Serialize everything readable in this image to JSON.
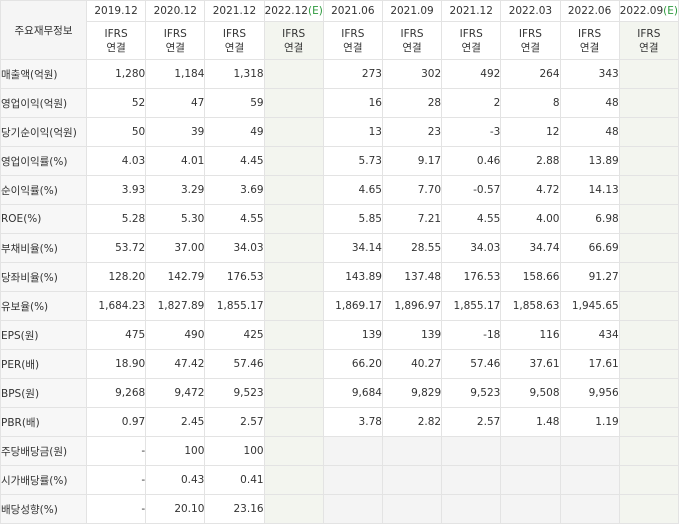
{
  "corner_label": "주요재무정보",
  "periods": [
    {
      "label": "2019.12",
      "est": false
    },
    {
      "label": "2020.12",
      "est": false
    },
    {
      "label": "2021.12",
      "est": false
    },
    {
      "label": "2022.12",
      "est": true
    },
    {
      "label": "2021.06",
      "est": false
    },
    {
      "label": "2021.09",
      "est": false
    },
    {
      "label": "2021.12",
      "est": false
    },
    {
      "label": "2022.03",
      "est": false
    },
    {
      "label": "2022.06",
      "est": false
    },
    {
      "label": "2022.09",
      "est": true
    }
  ],
  "est_mark": "(E)",
  "basis_line1": "IFRS",
  "basis_line2": "연결",
  "rows": [
    {
      "label": "매출액(억원)",
      "values": [
        "1,280",
        "1,184",
        "1,318",
        "",
        "273",
        "302",
        "492",
        "264",
        "343",
        ""
      ]
    },
    {
      "label": "영업이익(억원)",
      "values": [
        "52",
        "47",
        "59",
        "",
        "16",
        "28",
        "2",
        "8",
        "48",
        ""
      ]
    },
    {
      "label": "당기순이익(억원)",
      "values": [
        "50",
        "39",
        "49",
        "",
        "13",
        "23",
        "-3",
        "12",
        "48",
        ""
      ]
    },
    {
      "label": "영업이익률(%)",
      "values": [
        "4.03",
        "4.01",
        "4.45",
        "",
        "5.73",
        "9.17",
        "0.46",
        "2.88",
        "13.89",
        ""
      ]
    },
    {
      "label": "순이익률(%)",
      "values": [
        "3.93",
        "3.29",
        "3.69",
        "",
        "4.65",
        "7.70",
        "-0.57",
        "4.72",
        "14.13",
        ""
      ]
    },
    {
      "label": "ROE(%)",
      "values": [
        "5.28",
        "5.30",
        "4.55",
        "",
        "5.85",
        "7.21",
        "4.55",
        "4.00",
        "6.98",
        ""
      ]
    },
    {
      "label": "부채비율(%)",
      "values": [
        "53.72",
        "37.00",
        "34.03",
        "",
        "34.14",
        "28.55",
        "34.03",
        "34.74",
        "66.69",
        ""
      ]
    },
    {
      "label": "당좌비율(%)",
      "values": [
        "128.20",
        "142.79",
        "176.53",
        "",
        "143.89",
        "137.48",
        "176.53",
        "158.66",
        "91.27",
        ""
      ]
    },
    {
      "label": "유보율(%)",
      "values": [
        "1,684.23",
        "1,827.89",
        "1,855.17",
        "",
        "1,869.17",
        "1,896.97",
        "1,855.17",
        "1,858.63",
        "1,945.65",
        ""
      ]
    },
    {
      "label": "EPS(원)",
      "values": [
        "475",
        "490",
        "425",
        "",
        "139",
        "139",
        "-18",
        "116",
        "434",
        ""
      ]
    },
    {
      "label": "PER(배)",
      "values": [
        "18.90",
        "47.42",
        "57.46",
        "",
        "66.20",
        "40.27",
        "57.46",
        "37.61",
        "17.61",
        ""
      ]
    },
    {
      "label": "BPS(원)",
      "values": [
        "9,268",
        "9,472",
        "9,523",
        "",
        "9,684",
        "9,829",
        "9,523",
        "9,508",
        "9,956",
        ""
      ]
    },
    {
      "label": "PBR(배)",
      "values": [
        "0.97",
        "2.45",
        "2.57",
        "",
        "3.78",
        "2.82",
        "2.57",
        "1.48",
        "1.19",
        ""
      ]
    },
    {
      "label": "주당배당금(원)",
      "values": [
        "-",
        "100",
        "100",
        "",
        "",
        "",
        "",
        "",
        "",
        ""
      ]
    },
    {
      "label": "시가배당률(%)",
      "values": [
        "-",
        "0.43",
        "0.41",
        "",
        "",
        "",
        "",
        "",
        "",
        ""
      ]
    },
    {
      "label": "배당성향(%)",
      "values": [
        "-",
        "20.10",
        "23.16",
        "",
        "",
        "",
        "",
        "",
        "",
        ""
      ]
    }
  ],
  "colors": {
    "negative": "#e11c1c",
    "basis": "#e4661c",
    "estimate_mark": "#2e9a3e"
  }
}
